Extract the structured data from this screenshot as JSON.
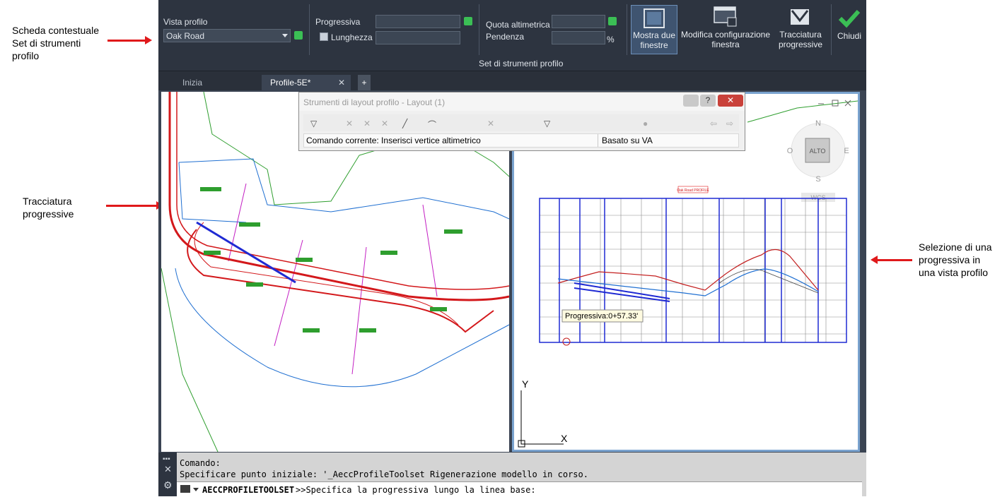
{
  "callouts": {
    "contextual": "Scheda contestuale\nSet di strumenti\nprofilo",
    "stations": "Tracciatura\nprogressive",
    "selection": "Selezione di una\nprogressiva in\nuna vista profilo"
  },
  "ribbon": {
    "vista_profilo_label": "Vista profilo",
    "vista_profilo_value": "Oak Road",
    "progressiva_label": "Progressiva",
    "lunghezza_label": "Lunghezza",
    "quota_label": "Quota altimetrica",
    "pendenza_label": "Pendenza",
    "percent": "%",
    "panel_title": "Set di strumenti profilo",
    "mostra_btn": "Mostra due\nfinestre",
    "modifica_btn": "Modifica configurazione\nfinestra",
    "tracciatura_btn": "Tracciatura\nprogressive",
    "chiudi_btn": "Chiudi"
  },
  "tabs": {
    "start": "Inizia",
    "active": "Profile-5E*",
    "add": "+"
  },
  "dialog": {
    "title": "Strumenti di layout profilo - Layout (1)",
    "current_command": "Comando corrente: Inserisci vertice altimetrico",
    "based_on": "Basato su VA"
  },
  "view": {
    "wcs": "WCS",
    "compass_n": "N",
    "compass_s": "S",
    "compass_e": "E",
    "compass_o": "O",
    "cube_face": "ALTO",
    "profile_title": "Oak Road PROFILE",
    "tooltip": "Progressiva:0+57.33'",
    "axis_y": "Y",
    "axis_x": "X"
  },
  "command": {
    "line1": "Comando:",
    "line2": "Specificare punto iniziale: '_AeccProfileToolset Rigenerazione modello in corso.",
    "prompt_cmd": "AECCPROFILETOOLSET",
    "prompt_text": ">>Specifica la progressiva lungo la linea base:"
  },
  "colors": {
    "accent_green": "#3bbf55",
    "arrow_red": "#e0191b",
    "ribbon_dark": "#2d3440"
  }
}
